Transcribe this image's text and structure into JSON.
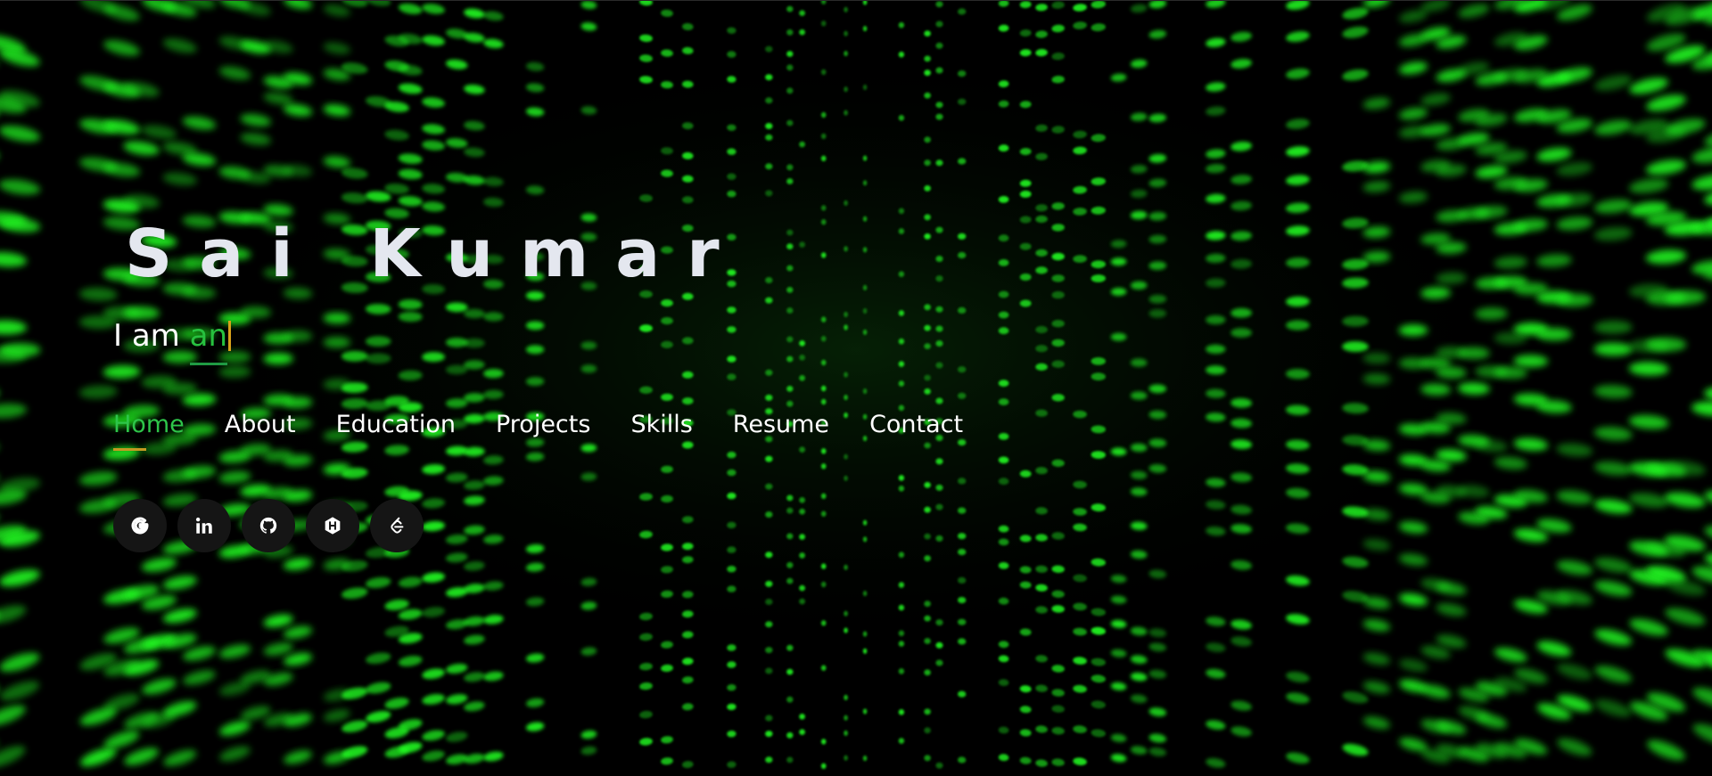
{
  "hero": {
    "name": "Sai Kumar",
    "tagline_prefix": "I am ",
    "tagline_typed": "an"
  },
  "nav": {
    "items": [
      {
        "label": "Home",
        "active": true
      },
      {
        "label": "About",
        "active": false
      },
      {
        "label": "Education",
        "active": false
      },
      {
        "label": "Projects",
        "active": false
      },
      {
        "label": "Skills",
        "active": false
      },
      {
        "label": "Resume",
        "active": false
      },
      {
        "label": "Contact",
        "active": false
      }
    ]
  },
  "social": {
    "icons": [
      "google-icon",
      "linkedin-icon",
      "github-icon",
      "hackerrank-icon",
      "leetcode-icon"
    ]
  },
  "colors": {
    "accent_green": "#2ec54a",
    "underline_gold": "#c49a22",
    "name_color": "#e4e7ef",
    "matrix_green": "#22ff22",
    "icon_bg": "#151515"
  }
}
